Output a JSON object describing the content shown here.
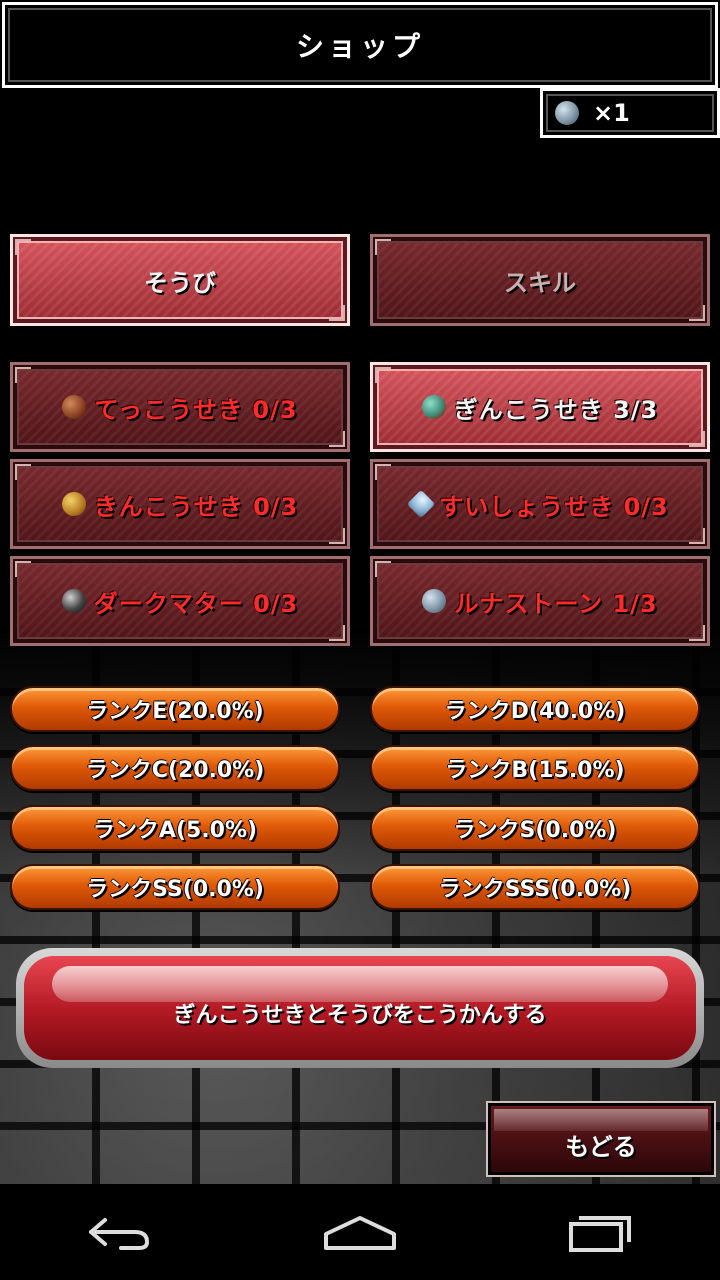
{
  "header": {
    "title": "ショップ"
  },
  "currency": {
    "icon": "silver-ore-icon",
    "count": "×1"
  },
  "tabs": [
    {
      "label": "そうび",
      "active": true
    },
    {
      "label": "スキル",
      "active": false
    }
  ],
  "materials": [
    {
      "label": "てっこうせき 0/3",
      "icon": "iron-ore-icon",
      "selected": false
    },
    {
      "label": "ぎんこうせき 3/3",
      "icon": "silver-ore-icon",
      "selected": true
    },
    {
      "label": "きんこうせき 0/3",
      "icon": "gold-ore-icon",
      "selected": false
    },
    {
      "label": "すいしょうせき 0/3",
      "icon": "crystal-icon",
      "selected": false
    },
    {
      "label": "ダークマター 0/3",
      "icon": "dark-matter-icon",
      "selected": false
    },
    {
      "label": "ルナストーン 1/3",
      "icon": "luna-stone-icon",
      "selected": false
    }
  ],
  "ranks": [
    "ランクE(20.0%)",
    "ランクD(40.0%)",
    "ランクC(20.0%)",
    "ランクB(15.0%)",
    "ランクA(5.0%)",
    "ランクS(0.0%)",
    "ランクSS(0.0%)",
    "ランクSSS(0.0%)"
  ],
  "exchange_button": {
    "label": "ぎんこうせきとそうびをこうかんする"
  },
  "back_button": {
    "label": "もどる"
  },
  "system_nav": {
    "back": "back-arrow-icon",
    "home": "home-icon",
    "recents": "recents-icon"
  }
}
